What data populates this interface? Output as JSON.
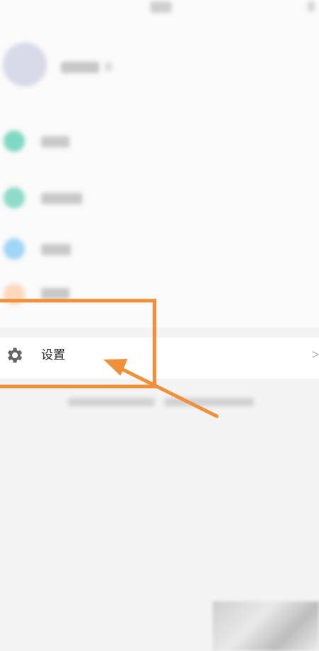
{
  "settings": {
    "label": "设置",
    "chevron": ">"
  },
  "colors": {
    "menu_icons": [
      "#7fd8c4",
      "#8edcc8",
      "#9fd6f6",
      "#fbd9bd"
    ],
    "annotation": "#f0903a",
    "row_background": "#ffffff",
    "page_background": "#f3f3f3"
  }
}
